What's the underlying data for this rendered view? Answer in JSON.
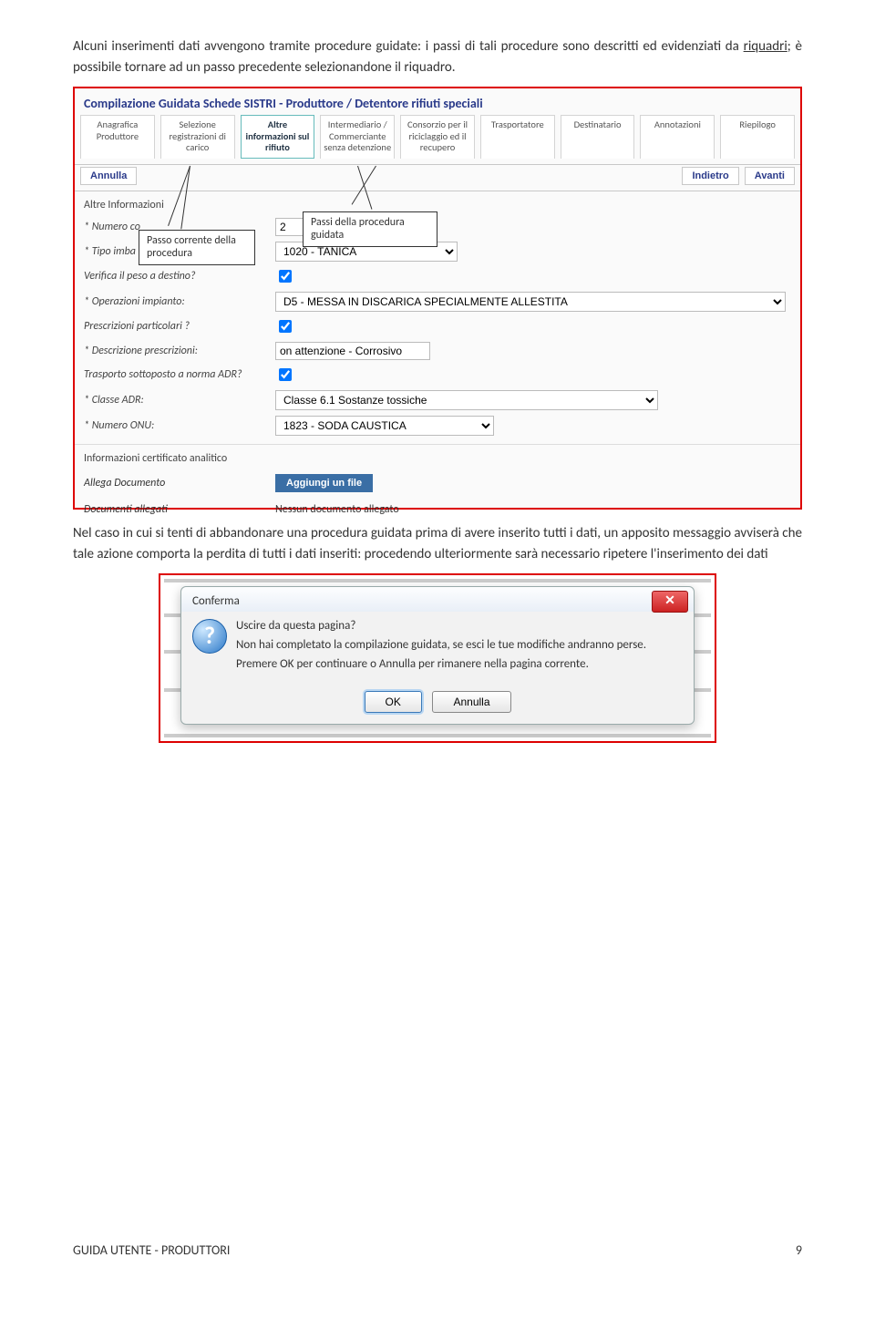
{
  "intro": {
    "text_pre": "Alcuni inserimenti dati avvengono tramite procedure guidate: i passi di tali procedure sono descritti ed evidenziati da ",
    "link": "riquadri",
    "text_post": "; è possibile tornare ad un passo precedente selezionandone il riquadro."
  },
  "shot1": {
    "title": "Compilazione Guidata Schede SISTRI - Produttore / Detentore rifiuti speciali",
    "tabs": [
      "Anagrafica Produttore",
      "Selezione registrazioni di carico",
      "Altre informazioni sul rifiuto",
      "Intermediario / Commerciante senza detenzione",
      "Consorzio per il riciclaggio ed il recupero",
      "Trasportatore",
      "Destinatario",
      "Annotazioni",
      "Riepilogo"
    ],
    "btns": {
      "annulla": "Annulla",
      "indietro": "Indietro",
      "avanti": "Avanti"
    },
    "section1": "Altre Informazioni",
    "rows": {
      "numero_co": {
        "label": "* Numero co",
        "value": "2"
      },
      "tipo_imba": {
        "label": "* Tipo imba",
        "value": "1020 - TANICA"
      },
      "verifica": {
        "label": "Verifica il peso a destino?"
      },
      "operazioni": {
        "label": "* Operazioni impianto:",
        "value": "D5 - MESSA IN DISCARICA SPECIALMENTE ALLESTITA"
      },
      "prescr_part": {
        "label": "Prescrizioni particolari ?"
      },
      "descr_prescr": {
        "label": "* Descrizione prescrizioni:",
        "value": "on attenzione - Corrosivo"
      },
      "trasporto_adr": {
        "label": "Trasporto sottoposto a norma ADR?"
      },
      "classe_adr": {
        "label": "* Classe ADR:",
        "value": "Classe 6.1 Sostanze tossiche"
      },
      "numero_onu": {
        "label": "* Numero ONU:",
        "value": "1823 - SODA CAUSTICA"
      }
    },
    "section2": "Informazioni certificato analitico",
    "attach": {
      "allega": "Allega Documento",
      "aggiungi": "Aggiungi un file",
      "allegati": "Documenti allegati",
      "nessuno": "Nessun documento allegato"
    },
    "callouts": {
      "passo_corrente": "Passo corrente della procedura",
      "passi_della": "Passi della procedura guidata"
    }
  },
  "mid_para": "Nel caso in cui si tenti di abbandonare una procedura guidata prima di avere inserito tutti i dati, un apposito messaggio avviserà che tale azione comporta la perdita di tutti i dati inseriti: procedendo ulteriormente sarà necessario ripetere l'inserimento dei dati",
  "dialog": {
    "title": "Conferma",
    "l1": "Uscire da questa pagina?",
    "l2": "Non hai completato la compilazione guidata, se esci le tue modifiche andranno perse.",
    "l3": "Premere OK per continuare o Annulla per rimanere nella pagina corrente.",
    "ok": "OK",
    "annulla": "Annulla"
  },
  "footer": {
    "left": "GUIDA UTENTE - PRODUTTORI",
    "right": "9"
  }
}
